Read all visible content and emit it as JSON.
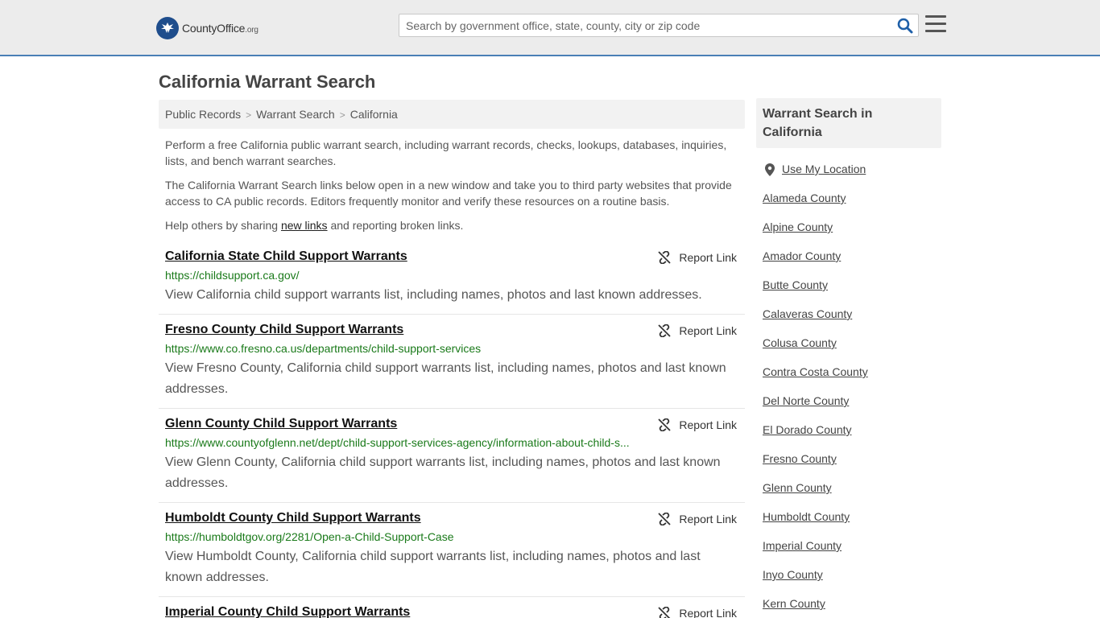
{
  "header": {
    "logo_main": "CountyOffice",
    "logo_org": ".org",
    "search_placeholder": "Search by government office, state, county, city or zip code"
  },
  "page": {
    "title": "California Warrant Search"
  },
  "breadcrumb": [
    "Public Records",
    "Warrant Search",
    "California"
  ],
  "intro": {
    "p1": "Perform a free California public warrant search, including warrant records, checks, lookups, databases, inquiries, lists, and bench warrant searches.",
    "p2": "The California Warrant Search links below open in a new window and take you to third party websites that provide access to CA public records. Editors frequently monitor and verify these resources on a routine basis.",
    "p3_before": "Help others by sharing ",
    "p3_link": "new links",
    "p3_after": " and reporting broken links."
  },
  "report_label": "Report Link",
  "results": [
    {
      "title": "California State Child Support Warrants",
      "url": "https://childsupport.ca.gov/",
      "desc": "View California child support warrants list, including names, photos and last known addresses."
    },
    {
      "title": "Fresno County Child Support Warrants",
      "url": "https://www.co.fresno.ca.us/departments/child-support-services",
      "desc": "View Fresno County, California child support warrants list, including names, photos and last known addresses."
    },
    {
      "title": "Glenn County Child Support Warrants",
      "url": "https://www.countyofglenn.net/dept/child-support-services-agency/information-about-child-s...",
      "desc": "View Glenn County, California child support warrants list, including names, photos and last known addresses."
    },
    {
      "title": "Humboldt County Child Support Warrants",
      "url": "https://humboldtgov.org/2281/Open-a-Child-Support-Case",
      "desc": "View Humboldt County, California child support warrants list, including names, photos and last known addresses."
    },
    {
      "title": "Imperial County Child Support Warrants",
      "url": "",
      "desc": ""
    }
  ],
  "sidebar": {
    "heading": "Warrant Search in California",
    "use_location": "Use My Location",
    "counties": [
      "Alameda County",
      "Alpine County",
      "Amador County",
      "Butte County",
      "Calaveras County",
      "Colusa County",
      "Contra Costa County",
      "Del Norte County",
      "El Dorado County",
      "Fresno County",
      "Glenn County",
      "Humboldt County",
      "Imperial County",
      "Inyo County",
      "Kern County"
    ]
  },
  "colors": {
    "accent_border": "#4a7fb6",
    "url_green": "#1a7a1a",
    "search_icon": "#1e5fa8"
  }
}
